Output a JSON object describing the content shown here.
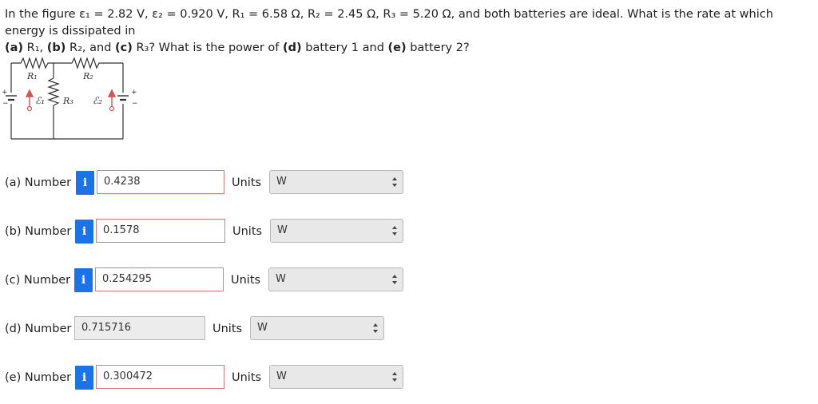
{
  "question": {
    "line1": "In the figure ε₁ = 2.82 V, ε₂ = 0.920 V, R₁ = 6.58 Ω, R₂ = 2.45 Ω, R₃ = 5.20 Ω, and both batteries are ideal. What is the rate at which energy is dissipated in",
    "part_a": "(a)",
    "r1": " R₁, ",
    "part_b": "(b)",
    "r2": " R₂, and ",
    "part_c": "(c)",
    "r3": " R₃? What is the power of ",
    "part_d": "(d)",
    "bat1": " battery 1 and ",
    "part_e": "(e)",
    "bat2": " battery 2?"
  },
  "circuit": {
    "r1_label": "R₁",
    "r2_label": "R₂",
    "r3_label": "R₃",
    "e1_label": "ℰ₁",
    "e2_label": "ℰ₂",
    "plus": "+",
    "minus": "−"
  },
  "rows": [
    {
      "label": "(a) Number",
      "value": "0.4238",
      "units_label": "Units",
      "unit": "W",
      "info": "i"
    },
    {
      "label": "(b) Number",
      "value": "0.1578",
      "units_label": "Units",
      "unit": "W",
      "info": "i"
    },
    {
      "label": "(c) Number",
      "value": "0.254295",
      "units_label": "Units",
      "unit": "W",
      "info": "i"
    },
    {
      "label": "(d) Number",
      "value": "0.715716",
      "units_label": "Units",
      "unit": "W"
    },
    {
      "label": "(e) Number",
      "value": "0.300472",
      "units_label": "Units",
      "unit": "W",
      "info": "i"
    }
  ]
}
